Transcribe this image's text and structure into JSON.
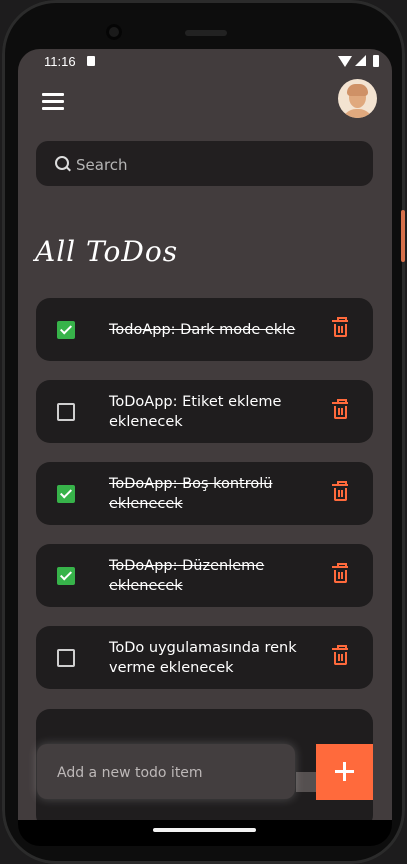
{
  "status_bar": {
    "time": "11:16"
  },
  "header": {
    "menu_icon": "hamburger-menu-icon",
    "avatar_icon": "user-avatar"
  },
  "search": {
    "placeholder": "Search",
    "icon": "search-icon"
  },
  "page_title": "All ToDos",
  "todos": [
    {
      "text": "TodoApp: Dark mode ekle",
      "done": true
    },
    {
      "text": "ToDoApp: Etiket ekleme eklenecek",
      "done": false
    },
    {
      "text": "ToDoApp: Boş kontrolü eklenecek",
      "done": true
    },
    {
      "text": "ToDoApp: Düzenleme eklenecek",
      "done": true
    },
    {
      "text": "ToDo uygulamasında renk verme eklenecek",
      "done": false
    }
  ],
  "new_todo": {
    "placeholder": "Add a new todo item"
  },
  "add_button": {
    "label": "+",
    "icon": "plus-icon"
  },
  "colors": {
    "background": "#423c3d",
    "card": "#1f1d1e",
    "accent": "#ff6a3c",
    "checked": "#37b34a"
  }
}
